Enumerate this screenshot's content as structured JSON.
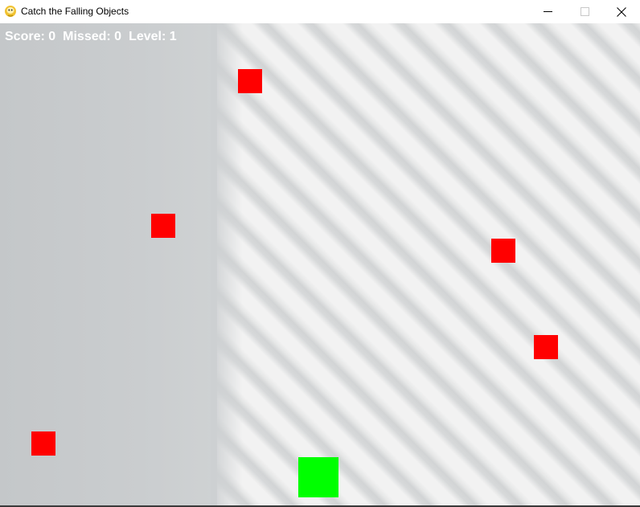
{
  "window": {
    "title": "Catch the Falling Objects",
    "icon": "python-snake-icon",
    "controls": [
      "minimize-icon",
      "maximize-icon",
      "close-icon"
    ]
  },
  "hud": {
    "score": "Score: 0",
    "missed": "Missed: 0",
    "level": "Level: 1"
  },
  "colors": {
    "falling_object": "#ff0000",
    "player": "#00ff00",
    "hud_text": "#ffffff"
  },
  "falling_objects_count": 5
}
